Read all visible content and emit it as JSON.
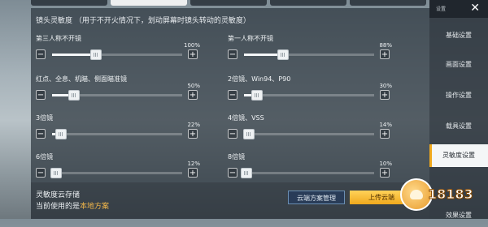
{
  "top_tabs": [
    "",
    "",
    "",
    "",
    ""
  ],
  "section": {
    "title": "镜头灵敏度 （用于不开火情况下，划动屏幕时镜头转动的灵敏度）"
  },
  "sliders": [
    {
      "label": "第三人称不开镜",
      "value": "100%",
      "level": 0.34
    },
    {
      "label": "第一人称不开镜",
      "value": "88%",
      "level": 0.3
    },
    {
      "label": "红点、全息、机瞄、侧面瞄准镜",
      "value": "50%",
      "level": 0.17
    },
    {
      "label": "2倍镜、Win94、P90",
      "value": "30%",
      "level": 0.1
    },
    {
      "label": "3倍镜",
      "value": "22%",
      "level": 0.07
    },
    {
      "label": "4倍镜、VSS",
      "value": "14%",
      "level": 0.04
    },
    {
      "label": "6倍镜",
      "value": "12%",
      "level": 0.03
    },
    {
      "label": "8倍镜",
      "value": "10%",
      "level": 0.02
    }
  ],
  "cloud": {
    "title": "灵敏度云存储",
    "current_prefix": "当前使用的是",
    "current_plan": "本地方案",
    "manage_button": "云端方案管理",
    "upload_button": "上传云端"
  },
  "sidebar": {
    "header": "设置",
    "items": [
      "基础设置",
      "画面设置",
      "操作设置",
      "载具设置",
      "灵敏度设置",
      "效果设置"
    ],
    "active_index": 4
  },
  "logo": {
    "text": "18183"
  },
  "colors": {
    "accent": "#f0a91d",
    "link": "#f1b64a"
  }
}
